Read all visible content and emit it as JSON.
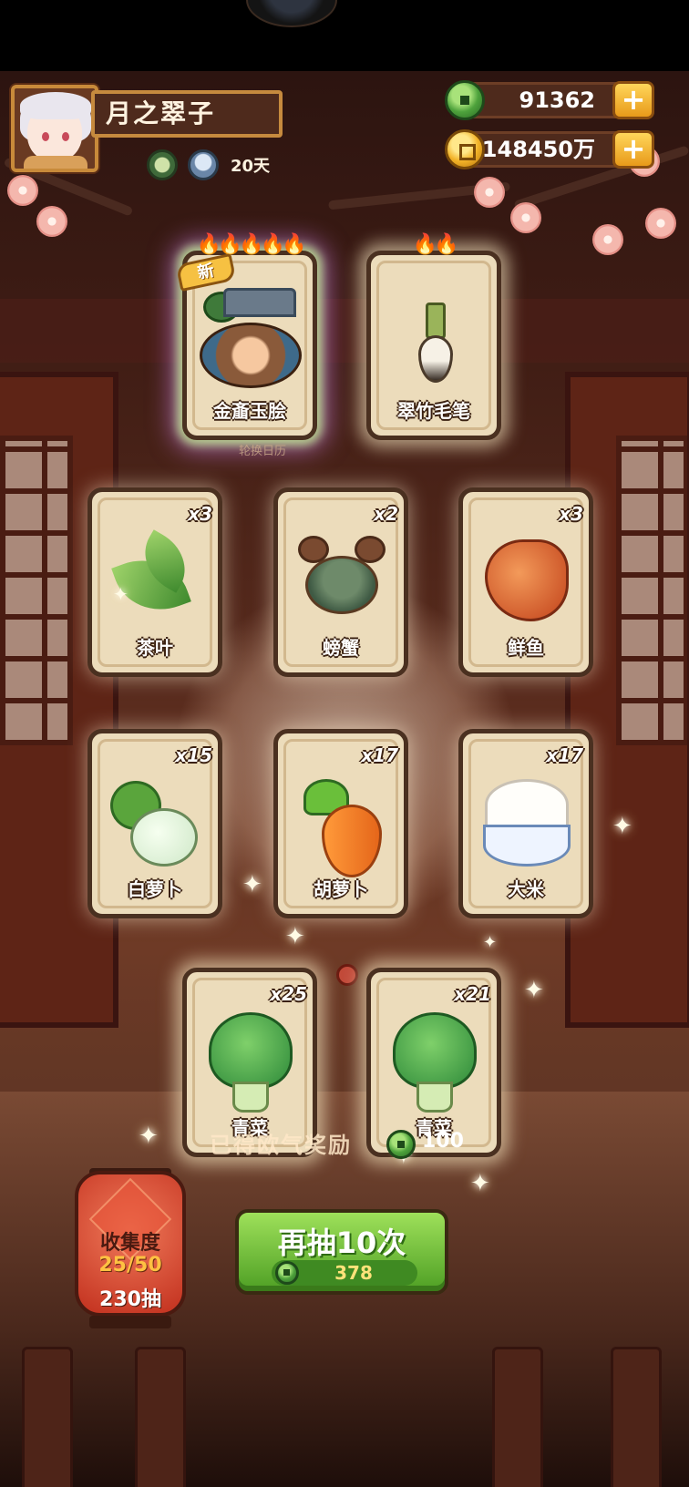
{
  "player": {
    "name": "月之翠子",
    "days": "20天"
  },
  "currency": {
    "jade": "91362",
    "gold": "148450万"
  },
  "featured_cards": [
    {
      "name": "金齑玉脍",
      "flames": "🔥🔥🔥🔥🔥",
      "badge": "新"
    },
    {
      "name": "翠竹毛笔",
      "flames": "🔥🔥"
    }
  ],
  "rotate_label": "轮换日历",
  "cards": [
    {
      "name": "茶叶",
      "count": "x3"
    },
    {
      "name": "螃蟹",
      "count": "x2"
    },
    {
      "name": "鲜鱼",
      "count": "x3"
    },
    {
      "name": "白萝卜",
      "count": "x15"
    },
    {
      "name": "胡萝卜",
      "count": "x17"
    },
    {
      "name": "大米",
      "count": "x17"
    },
    {
      "name": "青菜",
      "count": "x25"
    },
    {
      "name": "青菜",
      "count": "x21"
    }
  ],
  "reward": {
    "label": "已得欧气奖励",
    "amount": "100"
  },
  "draw_button": {
    "label": "再抽10次",
    "cost": "378"
  },
  "collection": {
    "title": "收集度",
    "progress": "25/50",
    "draws": "230抽"
  },
  "icons": {
    "jade": "jade-coin-icon",
    "gold": "gold-coin-icon",
    "plus": "plus-icon",
    "flame": "flame-icon",
    "sparkle": "sparkle-icon"
  },
  "colors": {
    "card_bg": "#ecdcbb",
    "card_border": "#4a3020",
    "button_green": "#4e9f24",
    "gold_accent": "#f2b227"
  }
}
